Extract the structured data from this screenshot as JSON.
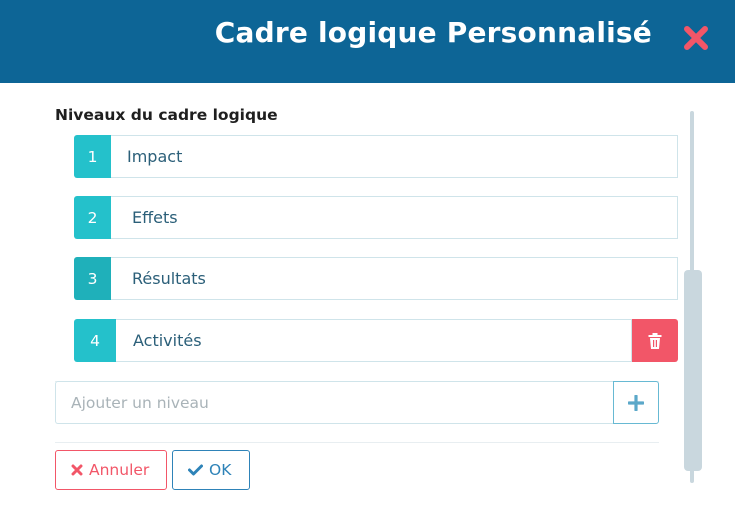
{
  "header": {
    "title": "Cadre logique Personnalisé",
    "close_icon": "close-icon",
    "background": "#0d6596",
    "close_color": "#f25668"
  },
  "section": {
    "title": "Niveaux du cadre logique"
  },
  "levels": [
    {
      "number": "1",
      "label": "Impact"
    },
    {
      "number": "2",
      "label": "Effets"
    },
    {
      "number": "3",
      "label": "Résultats"
    },
    {
      "number": "4",
      "label": "Activités",
      "delete_icon": "trash-icon"
    }
  ],
  "add_level": {
    "value": "",
    "placeholder": "Ajouter un niveau",
    "button_icon": "plus-icon"
  },
  "actions": {
    "cancel_label": "Annuler",
    "cancel_icon": "close-icon",
    "ok_label": "OK",
    "ok_icon": "check-icon"
  },
  "colors": {
    "accent_teal": "#24c1cb",
    "danger": "#f25668",
    "primary": "#2e83b8",
    "text_blue": "#2b5f79"
  }
}
